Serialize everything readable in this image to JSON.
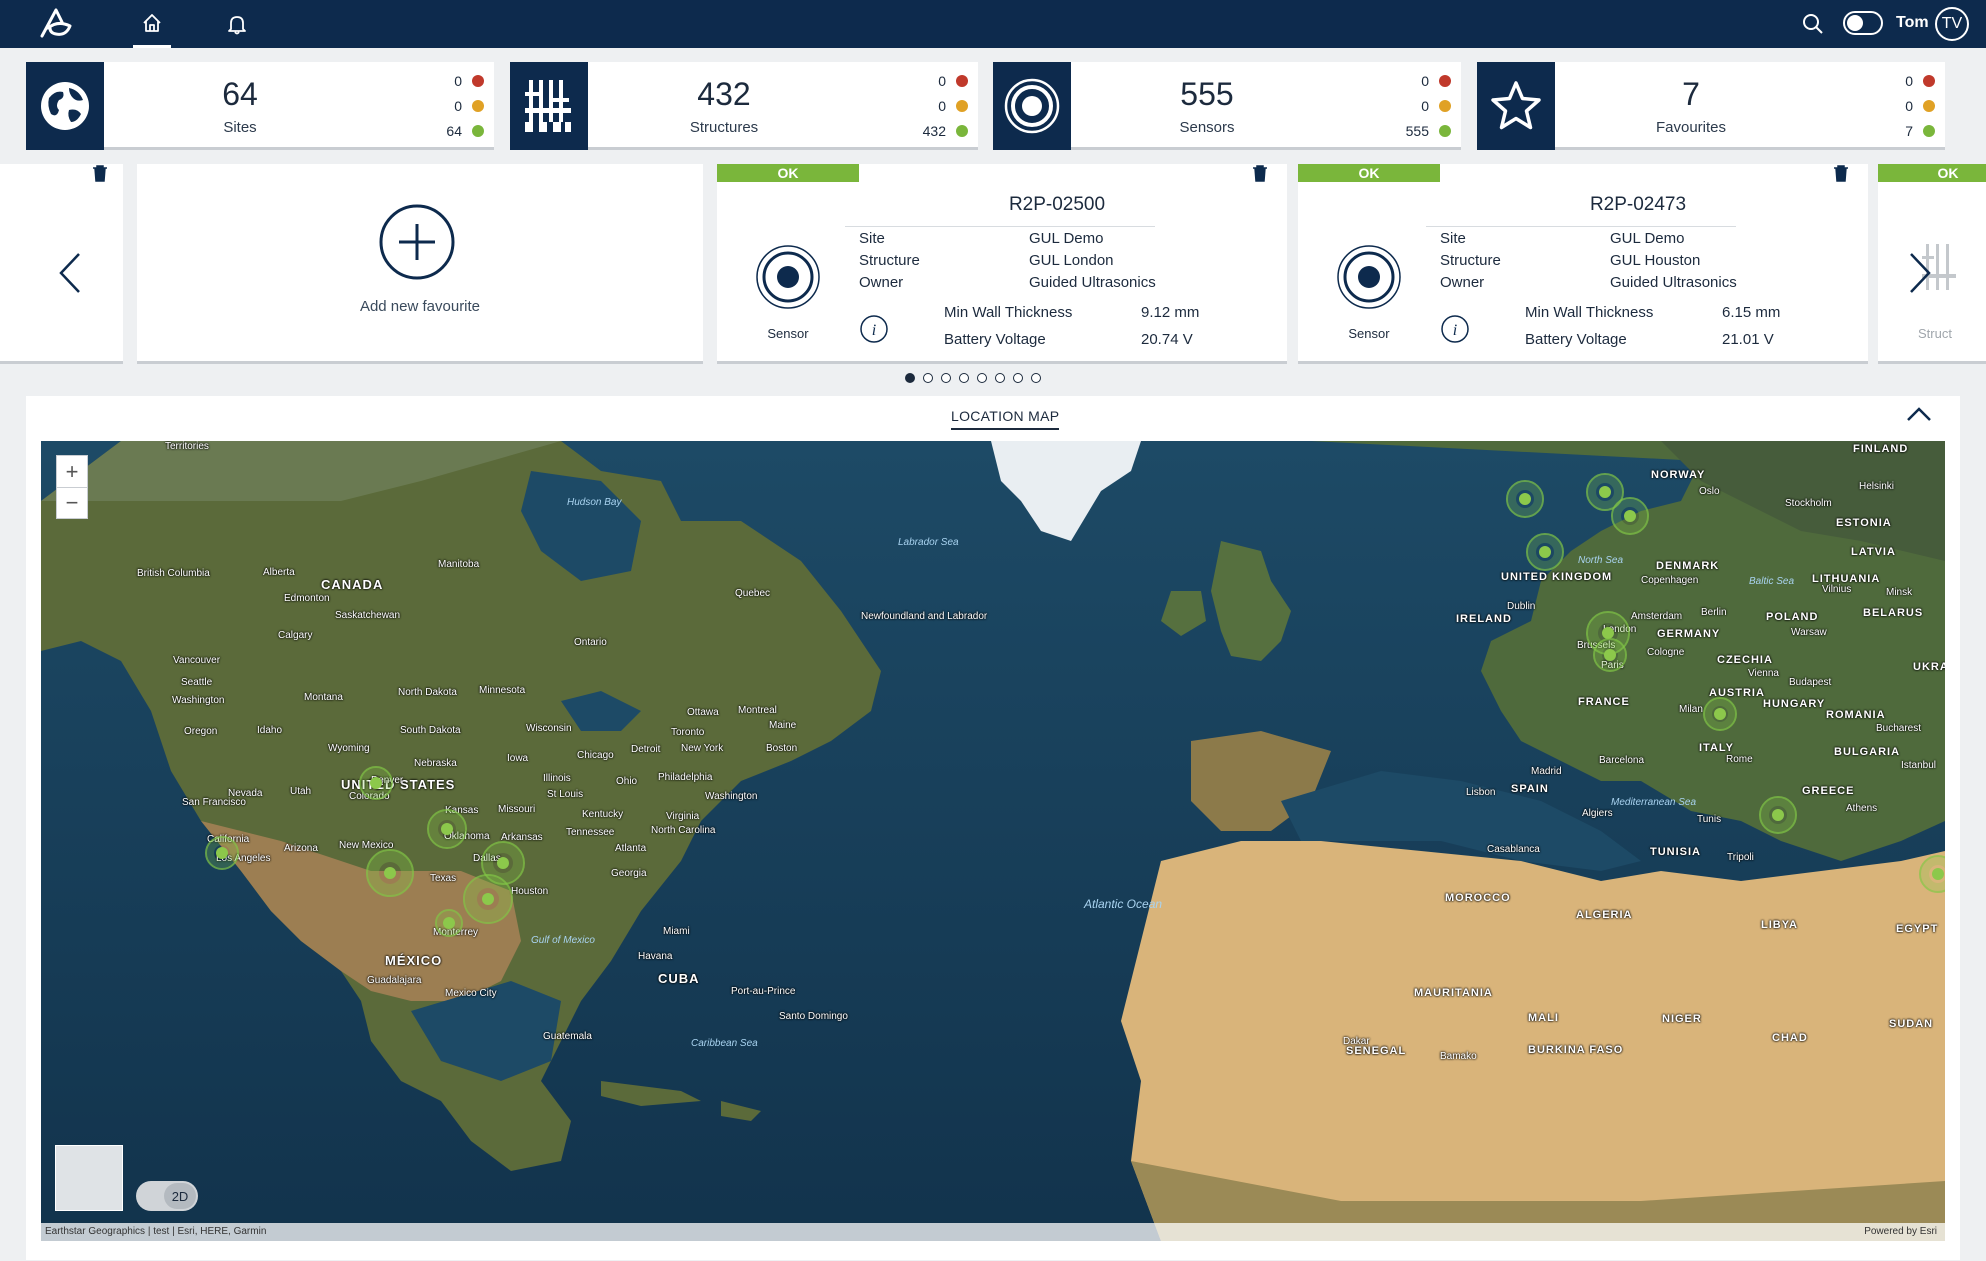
{
  "header": {
    "user_name": "Tom",
    "avatar_initials": "TV",
    "icons": [
      "logo-icon",
      "home-icon",
      "bell-icon",
      "search-icon",
      "theme-toggle"
    ]
  },
  "stats": [
    {
      "value": "64",
      "label": "Sites",
      "red": "0",
      "amber": "0",
      "green": "64",
      "icon": "globe-icon"
    },
    {
      "value": "432",
      "label": "Structures",
      "red": "0",
      "amber": "0",
      "green": "432",
      "icon": "structure-icon"
    },
    {
      "value": "555",
      "label": "Sensors",
      "red": "0",
      "amber": "0",
      "green": "555",
      "icon": "sensor-icon"
    },
    {
      "value": "7",
      "label": "Favourites",
      "red": "0",
      "amber": "0",
      "green": "7",
      "icon": "star-icon"
    }
  ],
  "colors": {
    "navy": "#0d2a4d",
    "ok_green": "#7ab63b",
    "red": "#c0392b",
    "amber": "#e0a125",
    "green": "#7ab63b"
  },
  "carousel": {
    "add_label": "Add new favourite",
    "cards": [
      {
        "status": "OK",
        "title": "R2P-02500",
        "sensor_label": "Sensor",
        "site_key": "Site",
        "site_val": "GUL Demo",
        "structure_key": "Structure",
        "structure_val": "GUL London",
        "owner_key": "Owner",
        "owner_val": "Guided Ultrasonics",
        "metric1_key": "Min Wall Thickness",
        "metric1_val": "9.12 mm",
        "metric2_key": "Battery Voltage",
        "metric2_val": "20.74 V"
      },
      {
        "status": "OK",
        "title": "R2P-02473",
        "sensor_label": "Sensor",
        "site_key": "Site",
        "site_val": "GUL Demo",
        "structure_key": "Structure",
        "structure_val": "GUL Houston",
        "owner_key": "Owner",
        "owner_val": "Guided Ultrasonics",
        "metric1_key": "Min Wall Thickness",
        "metric1_val": "6.15 mm",
        "metric2_key": "Battery Voltage",
        "metric2_val": "21.01 V"
      }
    ],
    "partial_right_status": "OK",
    "partial_right_label": "Struct",
    "page_count": 8,
    "active_page": 1
  },
  "map": {
    "title": "LOCATION MAP",
    "zoom_in": "+",
    "zoom_out": "−",
    "view_mode": "2D",
    "attribution": "Earthstar Geographics | test | Esri, HERE, Garmin",
    "powered_by": "Powered by Esri",
    "labels": {
      "canada": "CANADA",
      "usa": "UNITED STATES",
      "mexico": "MÉXICO",
      "cuba": "CUBA",
      "hudson": "Hudson Bay",
      "labrador": "Labrador Sea",
      "atlantic": "Atlantic Ocean",
      "gulf": "Gulf of Mexico",
      "caribbean": "Caribbean Sea",
      "north_sea": "North Sea",
      "med": "Mediterranean Sea",
      "baltic": "Baltic Sea",
      "uk": "UNITED KINGDOM",
      "ireland": "IRELAND",
      "france": "FRANCE",
      "spain": "SPAIN",
      "germany": "GERMANY",
      "norway": "NORWAY",
      "finland": "FINLAND",
      "italy": "ITALY",
      "poland": "POLAND",
      "denmark": "DENMARK",
      "morocco": "MOROCCO",
      "algeria": "ALGERIA",
      "libya": "LIBYA",
      "egypt": "EGYPT",
      "mauritania": "MAURITANIA",
      "mali": "MALI",
      "niger": "NIGER",
      "chad": "CHAD",
      "sudan": "SUDAN",
      "tunisia": "TUNISIA",
      "greece": "GREECE",
      "romania": "ROMANIA",
      "bulgaria": "BULGARIA",
      "hungary": "HUNGARY",
      "austria": "AUSTRIA",
      "czechia": "CZECHIA",
      "lithuania": "LITHUANIA",
      "latvia": "LATVIA",
      "estonia": "ESTONIA",
      "belarus": "BELARUS",
      "ukraine": "UKRAI",
      "senegal": "SENEGAL",
      "burkina": "BURKINA FASO",
      "houston": "Houston",
      "dallas": "Dallas",
      "london": "London",
      "paris": "Paris",
      "los_angeles": "Los Angeles",
      "denver": "Denver",
      "new_york": "New York",
      "chicago": "Chicago",
      "toronto": "Toronto",
      "montreal": "Montreal",
      "ottawa": "Ottawa",
      "miami": "Miami",
      "boston": "Boston",
      "washington": "Washington",
      "atlanta": "Atlanta",
      "mexico_city": "Mexico City",
      "havana": "Havana",
      "monterrey": "Monterrey",
      "dublin": "Dublin",
      "amsterdam": "Amsterdam",
      "berlin": "Berlin",
      "madrid": "Madrid",
      "lisbon": "Lisbon",
      "rome": "Rome",
      "milan": "Milan",
      "oslo": "Oslo",
      "stockholm": "Stockholm",
      "helsinki": "Helsinki",
      "vienna": "Vienna",
      "budapest": "Budapest",
      "warsaw": "Warsaw",
      "barcelona": "Barcelona",
      "tunis": "Tunis",
      "tripoli": "Tripoli",
      "algiers": "Algiers",
      "casablanca": "Casablanca",
      "athens": "Athens",
      "bucharest": "Bucharest",
      "istanbul": "Istanbul",
      "copenhagen": "Copenhagen",
      "minsk": "Minsk",
      "vilnius": "Vilnius",
      "brussels": "Brussels",
      "cologne": "Cologne",
      "dakar": "Dakar",
      "bamako": "Bamako",
      "vancouver": "Vancouver",
      "seattle": "Seattle",
      "calgary": "Calgary",
      "edmonton": "Edmonton",
      "quebec": "Quebec",
      "ontario": "Ontario",
      "manitoba": "Manitoba",
      "saskatchewan": "Saskatchewan",
      "alberta": "Alberta",
      "british_columbia": "British Columbia",
      "newfoundland": "Newfoundland and Labrador",
      "texas": "Texas",
      "california": "California",
      "arizona": "Arizona",
      "new_mexico": "New Mexico",
      "colorado": "Colorado",
      "kansas": "Kansas",
      "oklahoma": "Oklahoma",
      "nevada": "Nevada",
      "utah": "Utah",
      "oregon": "Oregon",
      "idaho": "Idaho",
      "montana": "Montana",
      "wyoming": "Wyoming",
      "north_dakota": "North Dakota",
      "south_dakota": "South Dakota",
      "nebraska": "Nebraska",
      "minnesota": "Minnesota",
      "iowa": "Iowa",
      "wisconsin": "Wisconsin",
      "illinois": "Illinois",
      "missouri": "Missouri",
      "arkansas": "Arkansas",
      "ohio": "Ohio",
      "kentucky": "Kentucky",
      "tennessee": "Tennessee",
      "virginia": "Virginia",
      "north_carolina": "North Carolina",
      "georgia": "Georgia",
      "maine": "Maine",
      "detroit": "Detroit",
      "philadelphia": "Philadelphia",
      "st_louis": "St Louis",
      "san_francisco": "San Francisco",
      "guadalajara": "Guadalajara",
      "guatemala": "Guatemala",
      "santo_domingo": "Santo Domingo",
      "port_au_prince": "Port-au-Prince",
      "territories": "Territories",
      "washington_state": "Washington"
    }
  }
}
